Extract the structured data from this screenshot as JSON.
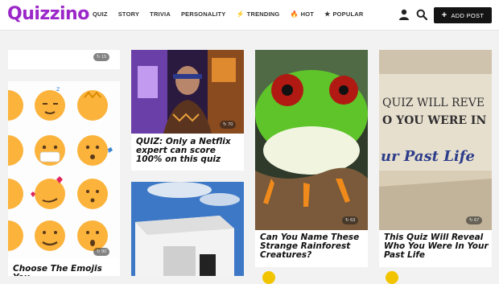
{
  "header": {
    "logo": "Quizzino",
    "nav": [
      {
        "label": "QUIZ",
        "icon": ""
      },
      {
        "label": "STORY",
        "icon": ""
      },
      {
        "label": "TRIVIA",
        "icon": ""
      },
      {
        "label": "PERSONALITY",
        "icon": ""
      },
      {
        "label": "TRENDING",
        "icon": "bolt-icon"
      },
      {
        "label": "HOT",
        "icon": "flame-icon"
      },
      {
        "label": "POPULAR",
        "icon": "star-icon"
      }
    ],
    "add_post_label": "ADD POST"
  },
  "cards": {
    "top_left_badge": "↻ 15",
    "emoji": {
      "title": "Choose The Emojis You",
      "badge": "↻ 90"
    },
    "netflix": {
      "title": "QUIZ: Only a Netflix expert can score 100% on this quiz",
      "badge": "↻ 70"
    },
    "frog": {
      "title": "Can You Name These Strange Rainforest Creatures?",
      "badge": "↻ 63"
    },
    "pastlife": {
      "title": "This Quiz Will Reveal Who You Were In Your Past Life",
      "badge": "↻ 67",
      "image_text_1": "QUIZ WILL REVE",
      "image_text_2": "O YOU WERE IN",
      "image_text_3": "ur Past Life"
    }
  },
  "colors": {
    "brand": "#9b27c9",
    "button": "#141414",
    "accent_dot": "#f2c400"
  }
}
